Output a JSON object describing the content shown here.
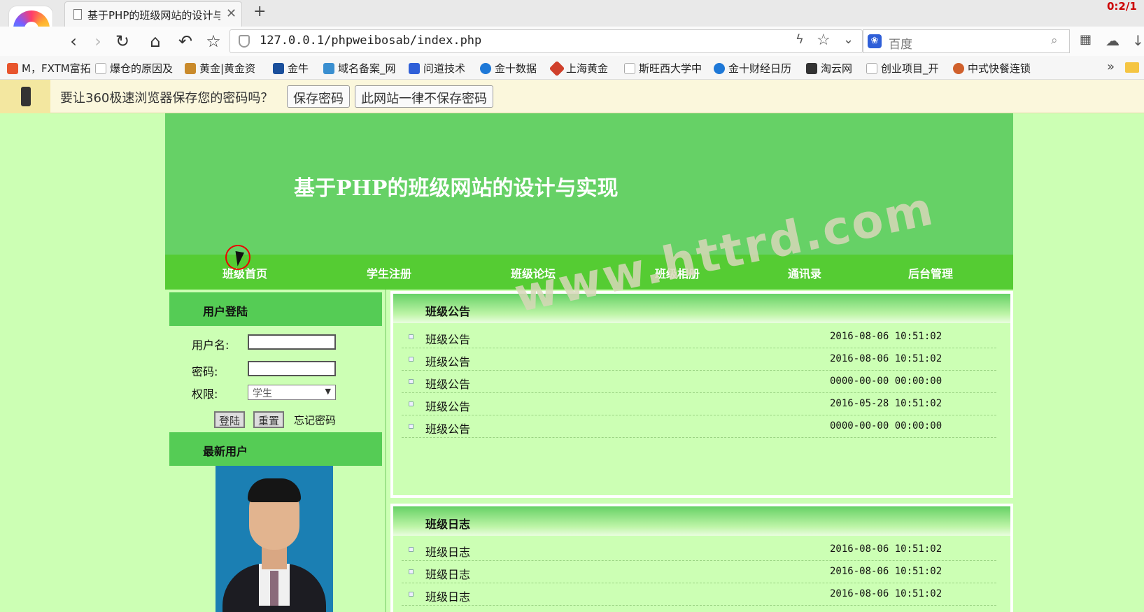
{
  "browser": {
    "tab_title": "基于PHP的班级网站的设计与",
    "tab_close": "✕",
    "new_tab": "+",
    "corner_text": "0:2/1",
    "url": "127.0.0.1/phpweibosab/index.php",
    "search_engine": "百度",
    "nav_icons": [
      "back-icon",
      "forward-icon",
      "reload-icon",
      "home-icon",
      "undo-icon",
      "star-icon"
    ]
  },
  "bookmarks": [
    {
      "label": "M，FXTM富拓",
      "color": "#e8552d"
    },
    {
      "label": "爆仓的原因及",
      "color": "#bbbbbb"
    },
    {
      "label": "黄金|黄金资",
      "color": "#c98a2b"
    },
    {
      "label": "金牛",
      "color": "#1a4f9c"
    },
    {
      "label": "域名备案_网",
      "color": "#3a8fd0"
    },
    {
      "label": "问道技术",
      "color": "#2f5fd8"
    },
    {
      "label": "金十数据",
      "color": "#1e78d7"
    },
    {
      "label": "上海黄金",
      "color": "#d0402b"
    },
    {
      "label": "斯旺西大学中",
      "color": "#bbbbbb"
    },
    {
      "label": "金十财经日历",
      "color": "#1e78d7"
    },
    {
      "label": "淘云网",
      "color": "#333333"
    },
    {
      "label": "创业项目_开",
      "color": "#bbbbbb"
    },
    {
      "label": "中式快餐连锁",
      "color": "#d0602b"
    }
  ],
  "bookmarks_more": "»",
  "password_bar": {
    "message": "要让360极速浏览器保存您的密码吗？",
    "save_btn": "保存密码",
    "never_btn": "此网站一律不保存密码"
  },
  "site": {
    "title": "基于PHP的班级网站的设计与实现",
    "menu": [
      "班级首页",
      "学生注册",
      "班级论坛",
      "班级相册",
      "通讯录",
      "后台管理"
    ],
    "login": {
      "header": "用户登陆",
      "username_label": "用户名:",
      "password_label": "密码:",
      "role_label": "权限:",
      "role_value": "学生",
      "login_btn": "登陆",
      "reset_btn": "重置",
      "forgot": "忘记密码"
    },
    "newest_users_header": "最新用户",
    "notices": {
      "header": "班级公告",
      "rows": [
        {
          "title": "班级公告",
          "date": "2016-08-06 10:51:02"
        },
        {
          "title": "班级公告",
          "date": "2016-08-06 10:51:02"
        },
        {
          "title": "班级公告",
          "date": "0000-00-00 00:00:00"
        },
        {
          "title": "班级公告",
          "date": "2016-05-28 10:51:02"
        },
        {
          "title": "班级公告",
          "date": "0000-00-00 00:00:00"
        }
      ]
    },
    "logs": {
      "header": "班级日志",
      "rows": [
        {
          "title": "班级日志",
          "date": "2016-08-06 10:51:02"
        },
        {
          "title": "班级日志",
          "date": "2016-08-06 10:51:02"
        },
        {
          "title": "班级日志",
          "date": "2016-08-06 10:51:02"
        }
      ]
    },
    "watermark": "www.httrd.com"
  }
}
